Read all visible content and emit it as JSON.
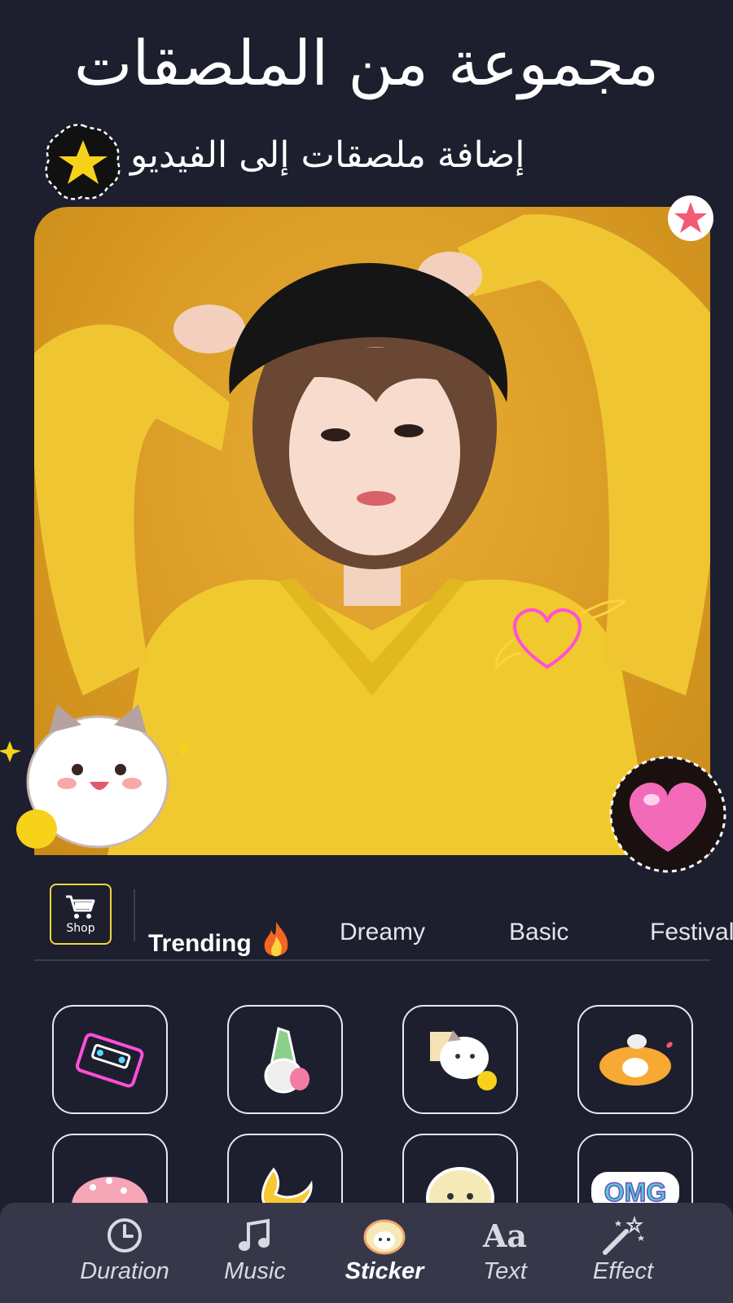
{
  "header": {
    "title": "مجموعة من الملصقات",
    "subtitle": "إضافة ملصقات إلى الفيديو"
  },
  "categories": {
    "shop_label": "Shop",
    "tabs": [
      {
        "label": "Trending",
        "active": true
      },
      {
        "label": "Dreamy",
        "active": false
      },
      {
        "label": "Basic",
        "active": false
      },
      {
        "label": "Festival",
        "active": false
      }
    ]
  },
  "stickers": [
    {
      "name": "neon-cassette-sticker"
    },
    {
      "name": "gnome-bunny-sticker"
    },
    {
      "name": "cat-with-flag-sticker"
    },
    {
      "name": "lying-cat-sticker"
    },
    {
      "name": "mushroom-sticker"
    },
    {
      "name": "moon-sticker"
    },
    {
      "name": "puppy-face-sticker"
    },
    {
      "name": "omg-sticker"
    }
  ],
  "bottom_nav": {
    "items": [
      {
        "label": "Duration",
        "icon": "clock-icon",
        "active": false
      },
      {
        "label": "Music",
        "icon": "music-note-icon",
        "active": false
      },
      {
        "label": "Sticker",
        "icon": "sticker-icon",
        "active": true
      },
      {
        "label": "Text",
        "icon": "text-aa-icon",
        "active": false
      },
      {
        "label": "Effect",
        "icon": "magic-wand-icon",
        "active": false
      }
    ]
  },
  "colors": {
    "background": "#1d1f2e",
    "nav_background": "#36384a",
    "shop_border": "#f2d53b",
    "photo_yellow": "#d99b24"
  }
}
